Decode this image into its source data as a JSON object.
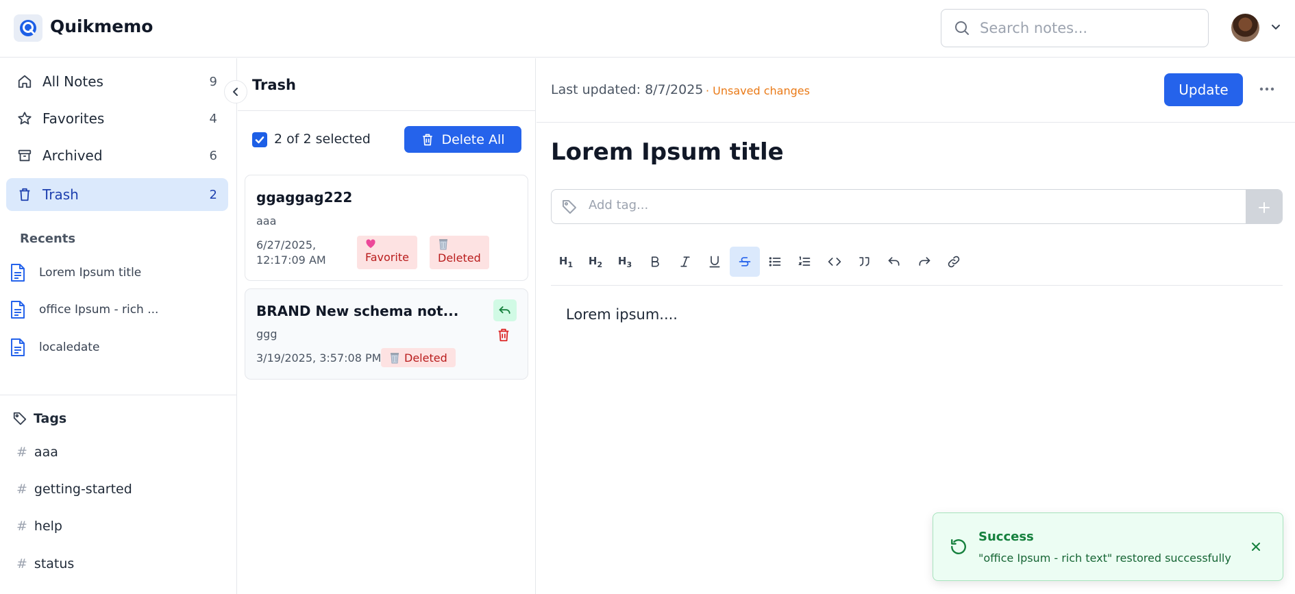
{
  "header": {
    "app_name": "Quikmemo",
    "search_placeholder": "Search notes..."
  },
  "sidebar": {
    "nav": [
      {
        "label": "All Notes",
        "count": "9",
        "icon": "home-icon"
      },
      {
        "label": "Favorites",
        "count": "4",
        "icon": "star-icon"
      },
      {
        "label": "Archived",
        "count": "6",
        "icon": "archive-icon"
      },
      {
        "label": "Trash",
        "count": "2",
        "icon": "trash-icon",
        "active": true
      }
    ],
    "recents_heading": "Recents",
    "recents": [
      {
        "label": "Lorem Ipsum title"
      },
      {
        "label": "office Ipsum - rich ..."
      },
      {
        "label": "localedate"
      }
    ],
    "tags_heading": "Tags",
    "tags": [
      {
        "label": "aaa"
      },
      {
        "label": "getting-started"
      },
      {
        "label": "help"
      },
      {
        "label": "status"
      }
    ],
    "hash": "#"
  },
  "trash": {
    "title": "Trash",
    "selection_text": "2 of 2 selected",
    "delete_all_label": "Delete All",
    "notes": [
      {
        "title": "ggaggag222",
        "body": "aaa",
        "date_line1": "6/27/2025,",
        "date_line2": "12:17:09 AM",
        "badges": [
          "Favorite",
          "Deleted"
        ]
      },
      {
        "title": "BRAND New schema not...",
        "body": "ggg",
        "date": "3/19/2025, 3:57:08 PM",
        "badges": [
          "Deleted"
        ]
      }
    ]
  },
  "editor": {
    "last_updated": "Last updated: 8/7/2025",
    "unsaved": "· Unsaved changes",
    "update_label": "Update",
    "title": "Lorem Ipsum title",
    "tag_placeholder": "Add tag...",
    "toolbar": [
      "H1",
      "H2",
      "H3",
      "bold",
      "italic",
      "underline",
      "strikethrough",
      "bullet-list",
      "ordered-list",
      "code",
      "quote",
      "undo",
      "redo",
      "link"
    ],
    "toolbar_active": "strikethrough",
    "heading_labels": {
      "h": "H",
      "h1": "1",
      "h2": "2",
      "h3": "3"
    },
    "content": "Lorem ipsum...."
  },
  "toast": {
    "title": "Success",
    "message": "\"office Ipsum - rich text\" restored successfully"
  },
  "colors": {
    "primary": "#2563eb",
    "active_bg": "#dbe9fc",
    "danger": "#dc2626",
    "success": "#15803d",
    "warning": "#ea7a17"
  }
}
